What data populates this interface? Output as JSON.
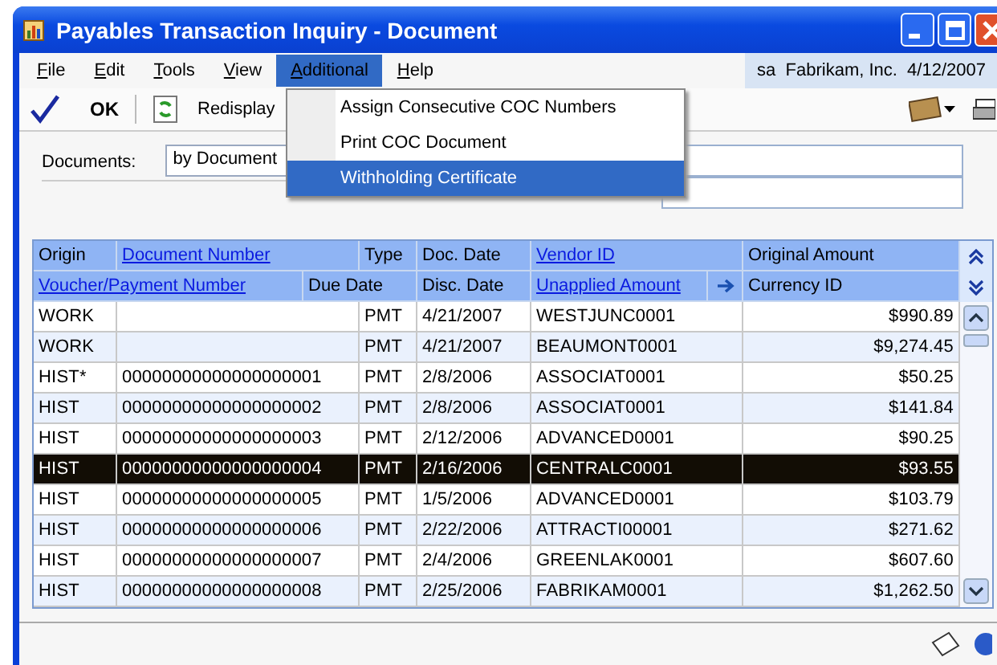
{
  "window": {
    "title": "Payables Transaction Inquiry - Document"
  },
  "menu": [
    {
      "label": "File",
      "selected": false
    },
    {
      "label": "Edit",
      "selected": false
    },
    {
      "label": "Tools",
      "selected": false
    },
    {
      "label": "View",
      "selected": false
    },
    {
      "label": "Additional",
      "selected": true
    },
    {
      "label": "Help",
      "selected": false
    }
  ],
  "open_menu": [
    {
      "label": "Assign Consecutive COC Numbers",
      "selected": false
    },
    {
      "label": "Print COC Document",
      "selected": false
    },
    {
      "label": "Withholding Certificate",
      "selected": true
    }
  ],
  "user_info": "sa  Fabrikam, Inc.  4/12/2007",
  "toolbar": {
    "ok": "OK",
    "redisplay": "Redisplay"
  },
  "form": {
    "documents_label": "Documents:",
    "documents_value": "by Document"
  },
  "grid": {
    "header_row_1": [
      {
        "label": "Origin",
        "link": false
      },
      {
        "label": "Document Number",
        "link": true
      },
      {
        "label": "Type",
        "link": false
      },
      {
        "label": "Doc. Date",
        "link": false
      },
      {
        "label": "Vendor ID",
        "link": true
      },
      {
        "label": "Original Amount",
        "link": false
      }
    ],
    "header_row_2": [
      {
        "label": "Voucher/Payment Number",
        "link": true
      },
      {
        "label": "Due Date",
        "link": false
      },
      {
        "label": "Disc. Date",
        "link": false
      },
      {
        "label": "Unapplied Amount",
        "link": true
      },
      {
        "label": "Currency ID",
        "link": false
      }
    ],
    "rows": [
      {
        "origin": "WORK",
        "document_number": "",
        "type": "PMT",
        "doc_date": "4/21/2007",
        "vendor_id": "WESTJUNC0001",
        "original_amount": "$990.89",
        "selected": false
      },
      {
        "origin": "WORK",
        "document_number": "",
        "type": "PMT",
        "doc_date": "4/21/2007",
        "vendor_id": "BEAUMONT0001",
        "original_amount": "$9,274.45",
        "selected": false
      },
      {
        "origin": "HIST*",
        "document_number": "00000000000000000001",
        "type": "PMT",
        "doc_date": "2/8/2006",
        "vendor_id": "ASSOCIAT0001",
        "original_amount": "$50.25",
        "selected": false
      },
      {
        "origin": "HIST",
        "document_number": "00000000000000000002",
        "type": "PMT",
        "doc_date": "2/8/2006",
        "vendor_id": "ASSOCIAT0001",
        "original_amount": "$141.84",
        "selected": false
      },
      {
        "origin": "HIST",
        "document_number": "00000000000000000003",
        "type": "PMT",
        "doc_date": "2/12/2006",
        "vendor_id": "ADVANCED0001",
        "original_amount": "$90.25",
        "selected": false
      },
      {
        "origin": "HIST",
        "document_number": "00000000000000000004",
        "type": "PMT",
        "doc_date": "2/16/2006",
        "vendor_id": "CENTRALC0001",
        "original_amount": "$93.55",
        "selected": true
      },
      {
        "origin": "HIST",
        "document_number": "00000000000000000005",
        "type": "PMT",
        "doc_date": "1/5/2006",
        "vendor_id": "ADVANCED0001",
        "original_amount": "$103.79",
        "selected": false
      },
      {
        "origin": "HIST",
        "document_number": "00000000000000000006",
        "type": "PMT",
        "doc_date": "2/22/2006",
        "vendor_id": "ATTRACTI00001",
        "original_amount": "$271.62",
        "selected": false
      },
      {
        "origin": "HIST",
        "document_number": "00000000000000000007",
        "type": "PMT",
        "doc_date": "2/4/2006",
        "vendor_id": "GREENLAK0001",
        "original_amount": "$607.60",
        "selected": false
      },
      {
        "origin": "HIST",
        "document_number": "00000000000000000008",
        "type": "PMT",
        "doc_date": "2/25/2006",
        "vendor_id": "FABRIKAM0001",
        "original_amount": "$1,262.50",
        "selected": false
      }
    ]
  }
}
